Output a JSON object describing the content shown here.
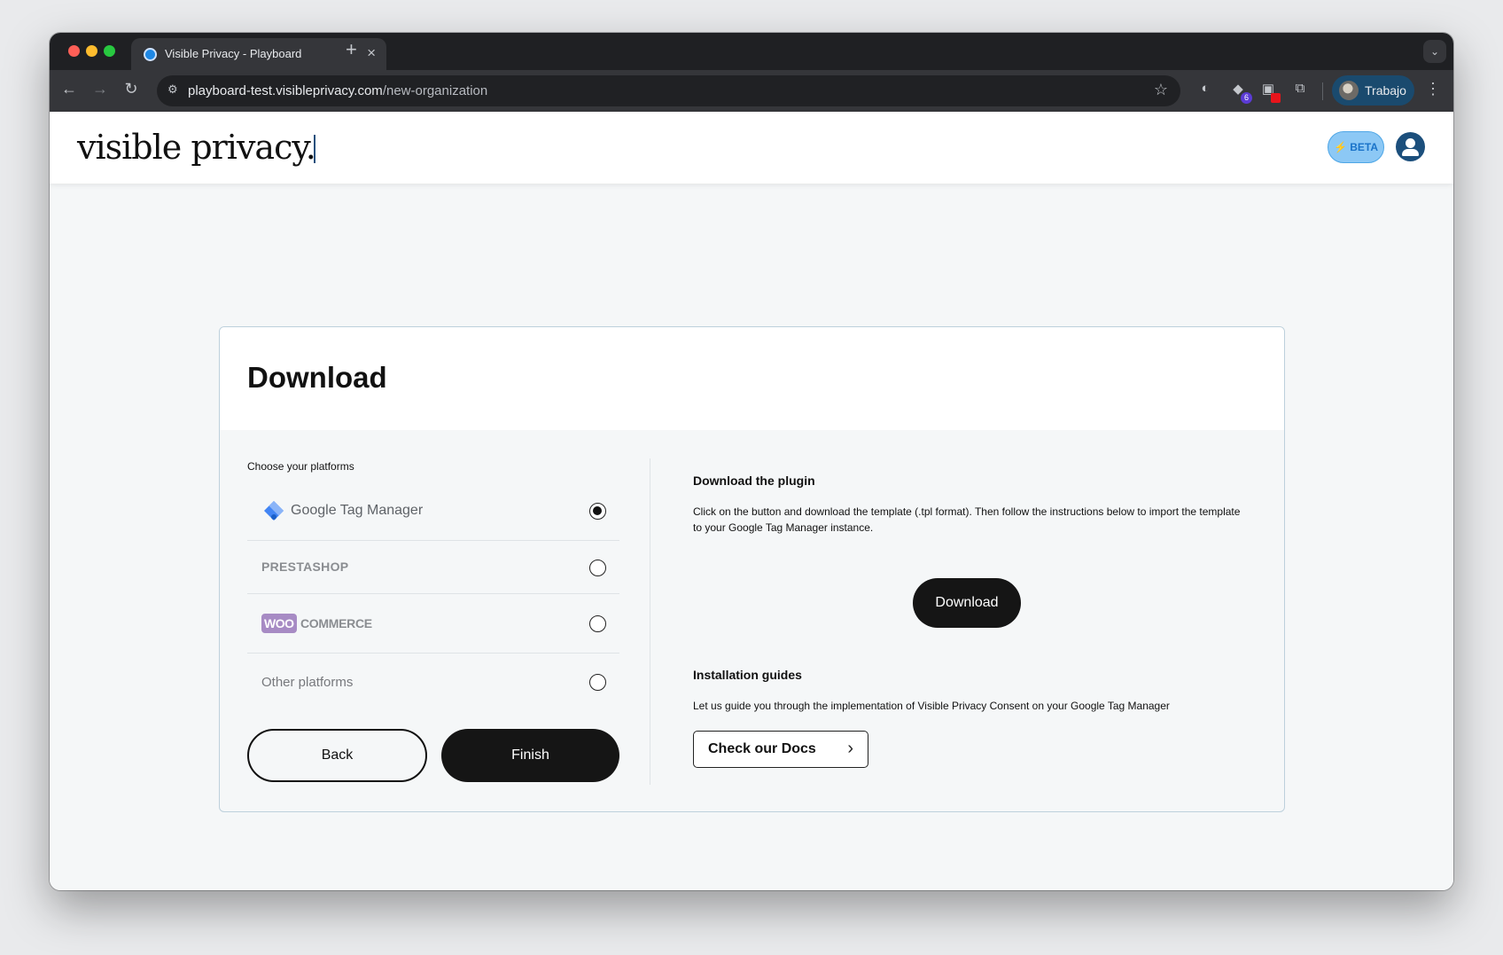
{
  "browser": {
    "tab_title": "Visible Privacy - Playboard",
    "tab_close": "×",
    "new_tab": "+",
    "tab_search": "⌄",
    "url_host": "playboard-test.visibleprivacy.com",
    "url_path": "/new-organization",
    "profile_label": "Trabajo",
    "extension_badge": "6",
    "icons": [
      "back-arrow-icon",
      "forward-arrow-icon",
      "reload-icon",
      "site-info-icon",
      "star-icon",
      "extension-icon",
      "puzzle-icon",
      "more-vert-icon"
    ]
  },
  "header": {
    "logo_text": "visible privacy.",
    "beta_label": "⚡ BETA",
    "accent_color": "#1c4f7c"
  },
  "card": {
    "title": "Download",
    "choose_label": "Choose your platforms",
    "platforms": [
      {
        "label": "Google Tag Manager",
        "selected": true
      },
      {
        "label": "PRESTASHOP",
        "selected": false
      },
      {
        "mark": "WOO",
        "label": "COMMERCE",
        "selected": false
      },
      {
        "label": "Other platforms",
        "selected": false
      }
    ],
    "back_label": "Back",
    "finish_label": "Finish",
    "download_heading": "Download the plugin",
    "download_desc": "Click on the button and download the template (.tpl format). Then follow the instructions below to import the template to your Google Tag Manager instance.",
    "download_label": "Download",
    "guides_heading": "Installation guides",
    "guides_desc": "Let us guide you through the implementation of Visible Privacy Consent on your Google Tag Manager",
    "docs_label": "Check our Docs"
  }
}
